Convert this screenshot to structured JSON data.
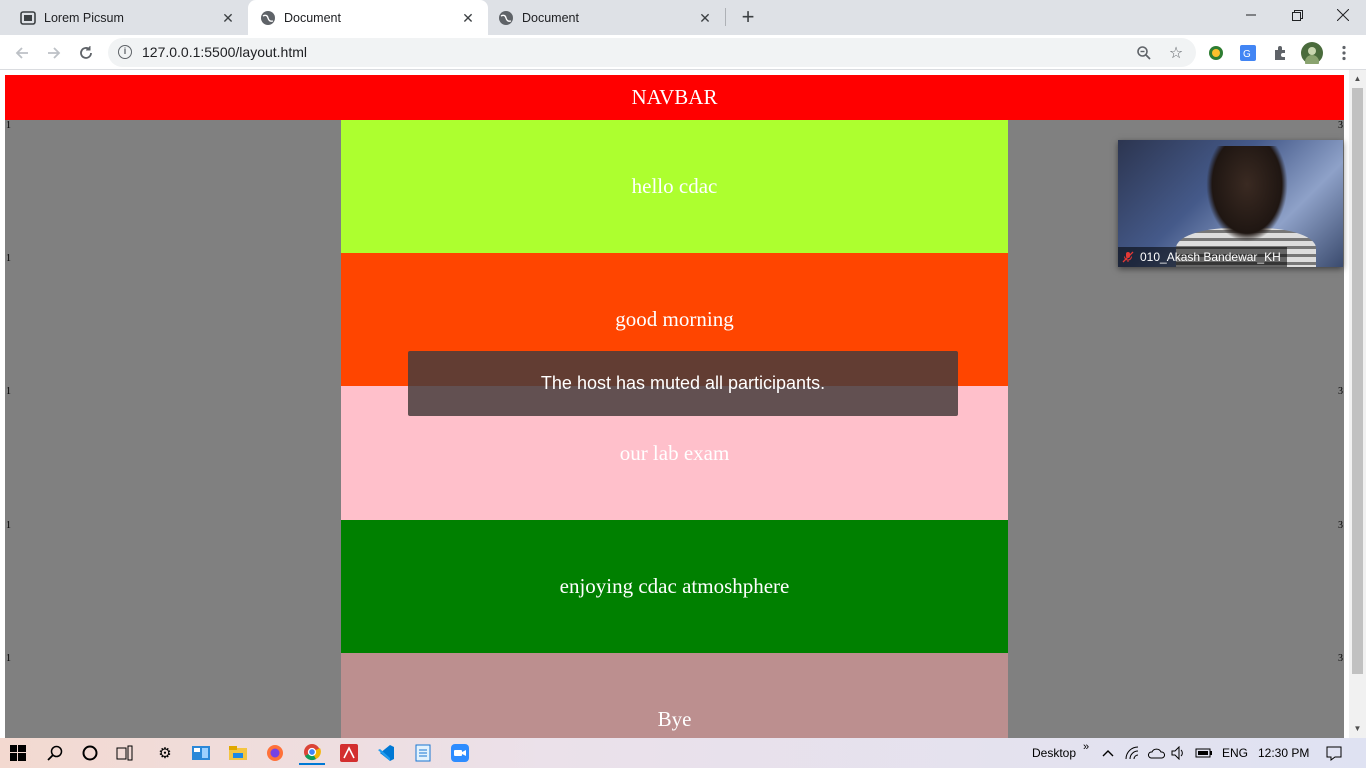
{
  "tabs": [
    {
      "title": "Lorem Picsum",
      "icon": "picsum-icon"
    },
    {
      "title": "Document",
      "icon": "globe-icon"
    },
    {
      "title": "Document",
      "icon": "globe-icon"
    }
  ],
  "toolbar": {
    "url": "127.0.0.1:5500/layout.html"
  },
  "page": {
    "navbar": "NAVBAR",
    "blocks": [
      {
        "text": "hello cdac",
        "color": "#adff2f"
      },
      {
        "text": "good morning",
        "color": "#ff4500"
      },
      {
        "text": "our lab exam",
        "color": "#ffc0cb"
      },
      {
        "text": "enjoying cdac atmoshphere",
        "color": "#008000"
      },
      {
        "text": "Bye",
        "color": "#bc8f8f"
      }
    ],
    "left_numbers": [
      "1",
      "1",
      "1",
      "1",
      "1"
    ],
    "right_numbers": [
      "3",
      "3",
      "3",
      "3"
    ]
  },
  "zoom": {
    "toast": "The host has muted all participants.",
    "participant_name": "010_Akash Bandewar_KH"
  },
  "taskbar": {
    "desktop_label": "Desktop",
    "chevrons": "»",
    "language": "ENG",
    "time": "12:30 PM"
  }
}
